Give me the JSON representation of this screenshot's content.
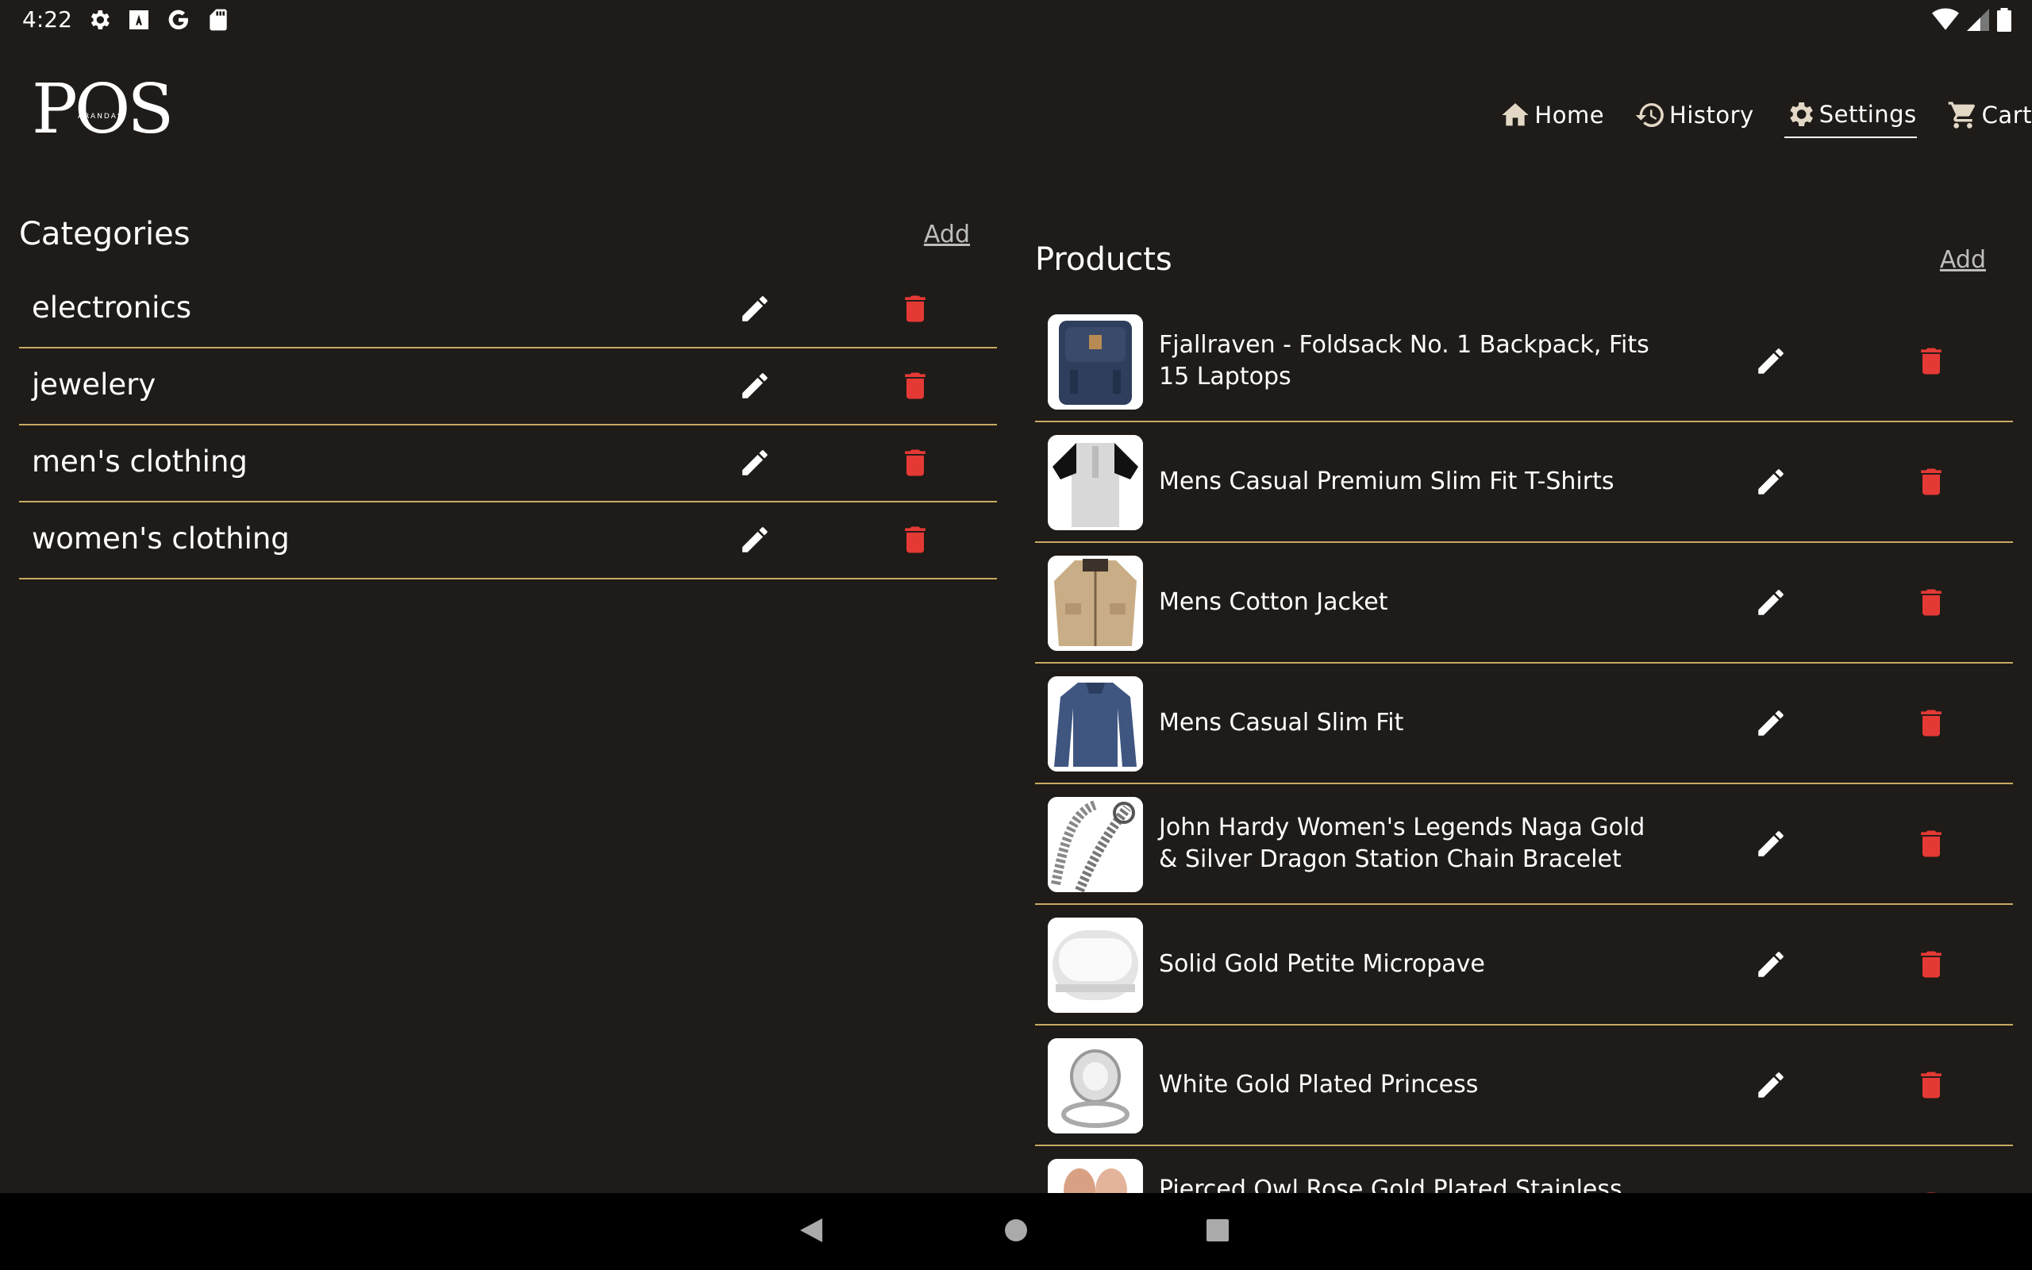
{
  "status_bar": {
    "time": "4:22"
  },
  "header": {
    "logo_text": "POS",
    "logo_sub": "ARANDAS"
  },
  "nav": {
    "items": [
      {
        "label": "Home",
        "icon": "home-icon"
      },
      {
        "label": "History",
        "icon": "history-icon"
      },
      {
        "label": "Settings",
        "icon": "gear-icon",
        "active": true
      },
      {
        "label": "Cart",
        "icon": "cart-icon"
      }
    ]
  },
  "categories": {
    "title": "Categories",
    "add_label": "Add",
    "items": [
      {
        "name": "electronics"
      },
      {
        "name": "jewelery"
      },
      {
        "name": "men's clothing"
      },
      {
        "name": "women's clothing"
      }
    ]
  },
  "products": {
    "title": "Products",
    "add_label": "Add",
    "items": [
      {
        "name": "Fjallraven - Foldsack No. 1 Backpack, Fits 15 Laptops",
        "thumb": "backpack"
      },
      {
        "name": "Mens Casual Premium Slim Fit T-Shirts",
        "thumb": "tshirt"
      },
      {
        "name": "Mens Cotton Jacket",
        "thumb": "jacket"
      },
      {
        "name": "Mens Casual Slim Fit",
        "thumb": "longsleeve"
      },
      {
        "name": "John Hardy Women's Legends Naga Gold & Silver Dragon Station Chain Bracelet",
        "thumb": "bracelet"
      },
      {
        "name": "Solid Gold Petite Micropave",
        "thumb": "ring-band"
      },
      {
        "name": "White Gold Plated Princess",
        "thumb": "ring-diamond"
      },
      {
        "name": "Pierced Owl Rose Gold Plated Stainless Steel",
        "thumb": "rose-ring"
      }
    ]
  },
  "colors": {
    "background": "#1e1b18",
    "divider": "#c9a961",
    "delete": "#e53935",
    "nav_icon": "#e3d8c6"
  }
}
